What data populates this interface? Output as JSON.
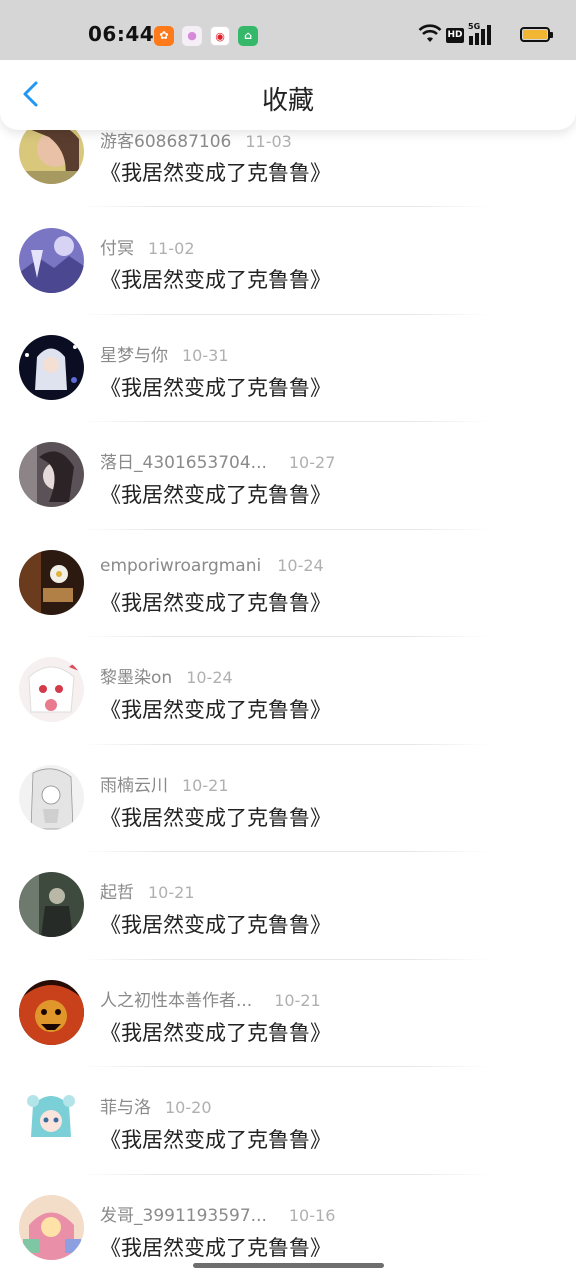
{
  "status_bar": {
    "time": "06:44",
    "app_icons": [
      "app-icon-orange",
      "app-icon-pink",
      "app-icon-red",
      "app-icon-green"
    ],
    "hd_label": "HD",
    "network_label": "5G",
    "battery_color": "#f2b632"
  },
  "header": {
    "back_icon": "chevron-left-icon",
    "title": "收藏"
  },
  "items": [
    {
      "user": "游客608687106",
      "date": "11-03",
      "book": "《我居然变成了克鲁鲁》"
    },
    {
      "user": "付冥",
      "date": "11-02",
      "book": "《我居然变成了克鲁鲁》"
    },
    {
      "user": "星梦与你",
      "date": "10-31",
      "book": "《我居然变成了克鲁鲁》"
    },
    {
      "user": "落日_4301653704...",
      "date": "10-27",
      "book": "《我居然变成了克鲁鲁》"
    },
    {
      "user": "emporiwroargmani",
      "date": "10-24",
      "book": "《我居然变成了克鲁鲁》"
    },
    {
      "user": "黎墨染on",
      "date": "10-24",
      "book": "《我居然变成了克鲁鲁》"
    },
    {
      "user": "雨楠云川",
      "date": "10-21",
      "book": "《我居然变成了克鲁鲁》"
    },
    {
      "user": "起哲",
      "date": "10-21",
      "book": "《我居然变成了克鲁鲁》"
    },
    {
      "user": "人之初性本善作者...",
      "date": "10-21",
      "book": "《我居然变成了克鲁鲁》"
    },
    {
      "user": "菲与洛",
      "date": "10-20",
      "book": "《我居然变成了克鲁鲁》"
    },
    {
      "user": "发哥_3991193597...",
      "date": "10-16",
      "book": "《我居然变成了克鲁鲁》"
    }
  ],
  "colors": {
    "accent": "#2196f3",
    "status_bar_bg": "#d6d6d6"
  }
}
